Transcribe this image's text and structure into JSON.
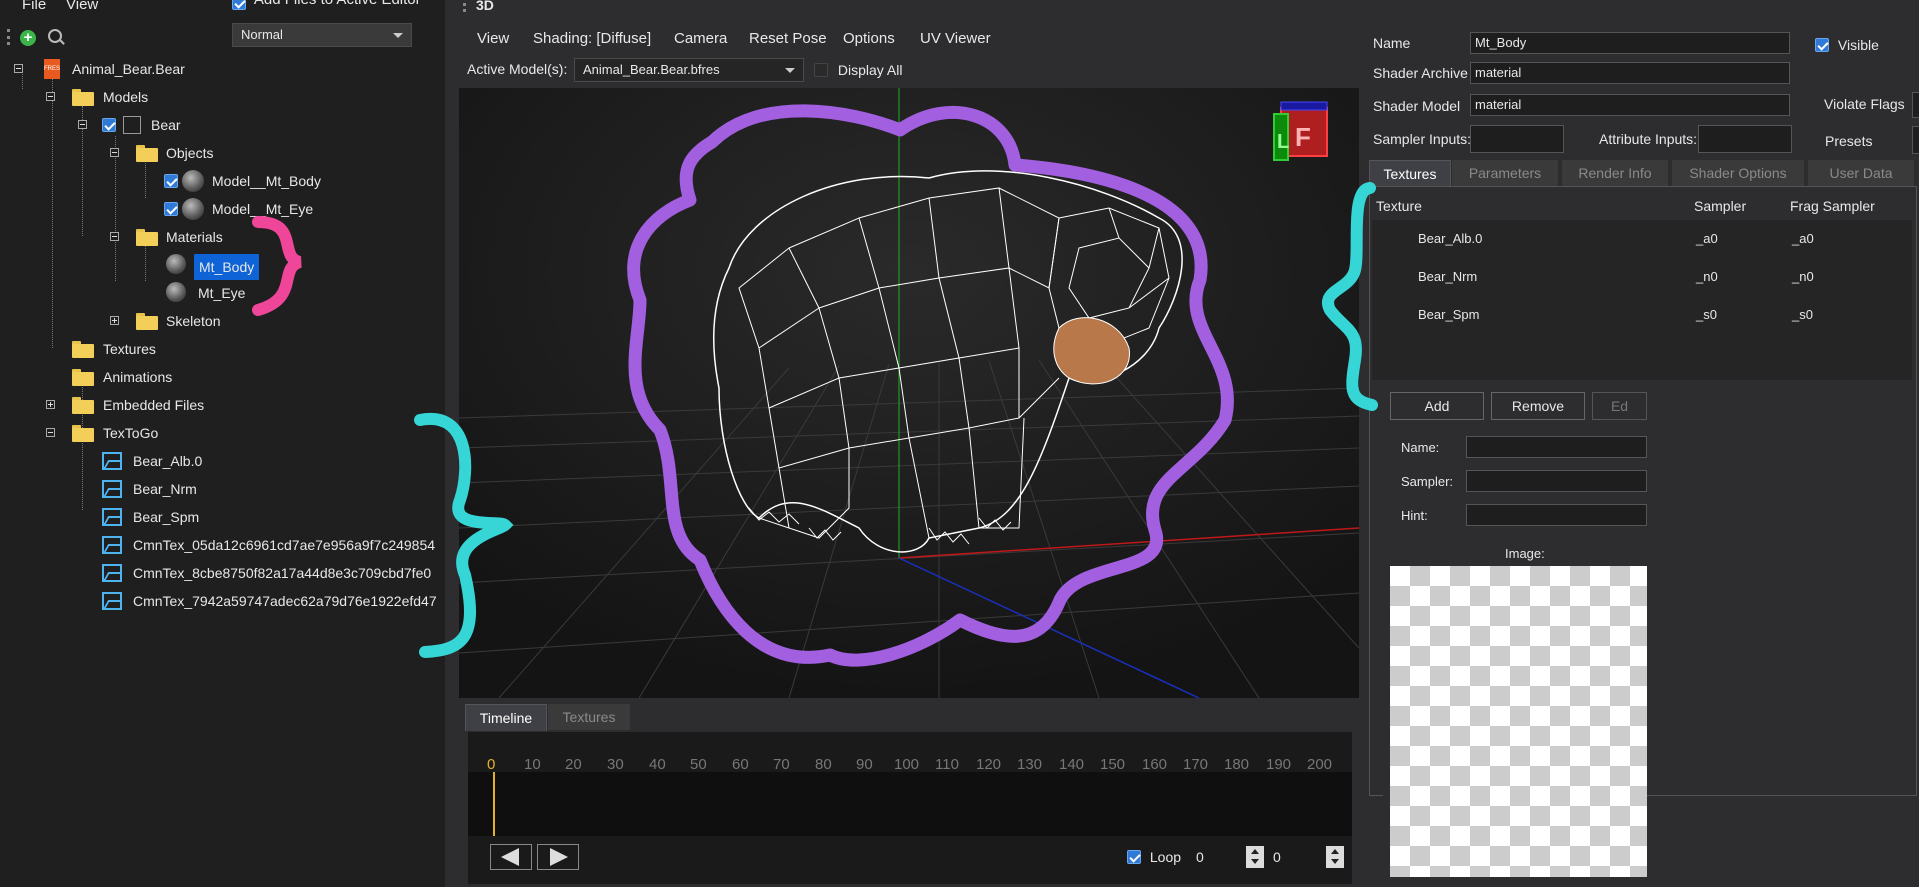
{
  "menu": {
    "file": "File",
    "view": "View",
    "add_files_label": "Add Files to Active Editor",
    "mode_select": "Normal"
  },
  "tree": {
    "root": "Animal_Bear.Bear",
    "root_badge": "FRES",
    "models": "Models",
    "bear": "Bear",
    "objects": "Objects",
    "obj_body": "Model__Mt_Body",
    "obj_eye": "Model__Mt_Eye",
    "materials": "Materials",
    "mat_body": "Mt_Body",
    "mat_eye": "Mt_Eye",
    "skeleton": "Skeleton",
    "textures": "Textures",
    "animations": "Animations",
    "embedded": "Embedded Files",
    "textogo": "TexToGo",
    "tex_items": [
      "Bear_Alb.0",
      "Bear_Nrm",
      "Bear_Spm",
      "CmnTex_05da12c6961cd7ae7e956a9f7c249854",
      "CmnTex_8cbe8750f82a17a44d8e3c709cbd7fe0",
      "CmnTex_7942a59747adec62a79d76e1922efd47"
    ]
  },
  "center": {
    "title": "3D",
    "toolbar": {
      "view": "View",
      "shading": "Shading: [Diffuse]",
      "camera": "Camera",
      "reset_pose": "Reset Pose",
      "options": "Options",
      "uv_viewer": "UV Viewer"
    },
    "active_models_label": "Active Model(s):",
    "active_model_value": "Animal_Bear.Bear.bfres",
    "display_all": "Display All",
    "gizmo_left": "L",
    "gizmo_front": "F"
  },
  "timeline": {
    "tab_timeline": "Timeline",
    "tab_textures": "Textures",
    "ticks": [
      "0",
      "10",
      "20",
      "30",
      "40",
      "50",
      "60",
      "70",
      "80",
      "90",
      "100",
      "110",
      "120",
      "130",
      "140",
      "150",
      "160",
      "170",
      "180",
      "190",
      "200"
    ],
    "loop": "Loop",
    "frame_value": "0",
    "frame_count": "0"
  },
  "material": {
    "name_label": "Name",
    "name_value": "Mt_Body",
    "visible_label": "Visible",
    "shader_archive_label": "Shader Archive",
    "shader_archive_value": "material",
    "shader_model_label": "Shader Model",
    "shader_model_value": "material",
    "violate_flags_label": "Violate Flags",
    "sampler_inputs_label": "Sampler Inputs:",
    "attribute_inputs_label": "Attribute Inputs:",
    "presets_label": "Presets",
    "tabs": [
      "Textures",
      "Parameters",
      "Render Info",
      "Shader Options",
      "User Data"
    ],
    "table_headers": [
      "Texture",
      "Sampler",
      "Frag Sampler"
    ],
    "rows": [
      {
        "texture": "Bear_Alb.0",
        "sampler": "_a0",
        "frag": "_a0"
      },
      {
        "texture": "Bear_Nrm",
        "sampler": "_n0",
        "frag": "_n0"
      },
      {
        "texture": "Bear_Spm",
        "sampler": "_s0",
        "frag": "_s0"
      }
    ],
    "add_button": "Add",
    "remove_button": "Remove",
    "edit_button": "Ed",
    "field_name": "Name:",
    "field_sampler": "Sampler:",
    "field_hint": "Hint:",
    "image_label": "Image:"
  },
  "colors": {
    "selection": "#0e63d6",
    "accent_checkbox": "#2f7ad6",
    "annot_purple": "#a25fe0",
    "annot_pink": "#f0469a",
    "annot_cyan": "#37d6d6",
    "timeline_marker": "#e3b12c"
  }
}
